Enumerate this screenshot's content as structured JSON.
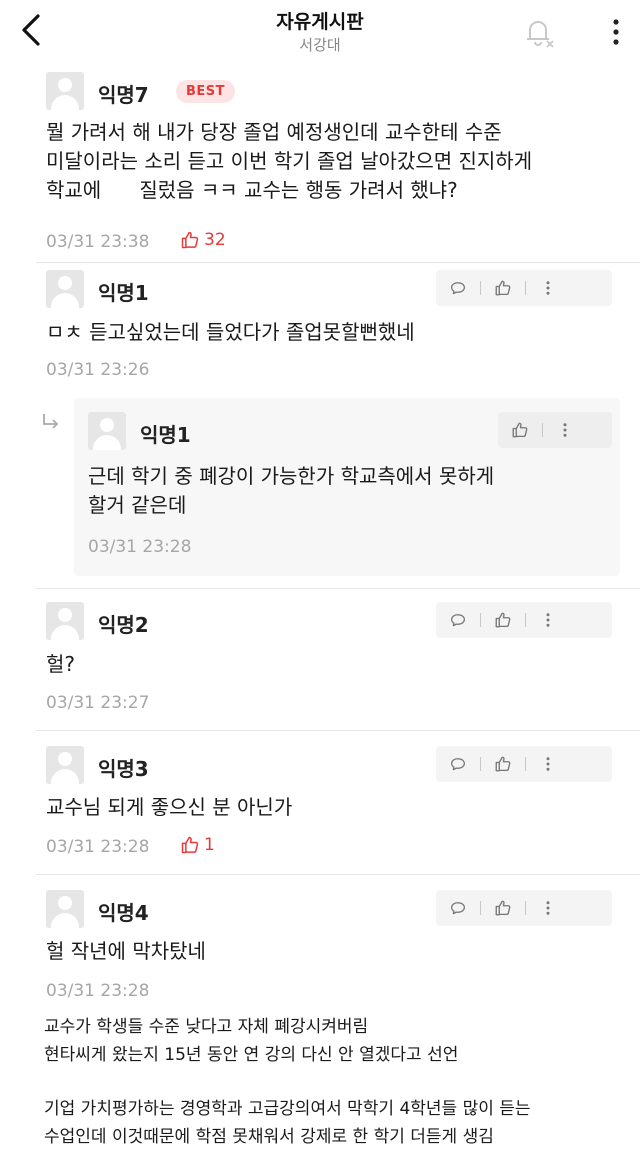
{
  "header": {
    "title": "자유게시판",
    "subtitle": "서강대"
  },
  "comments": [
    {
      "author": "익명7",
      "badge": "BEST",
      "text_lines": [
        "뭘 가려서 해 내가 당장 졸업 예정생인데 교수한테 수준",
        "미달이라는 소리 듣고 이번 학기 졸업 날아갔으면 진지하게",
        "학교에      질렀음 ㅋㅋ 교수는 행동 가려서 했냐?"
      ],
      "time": "03/31 23:38",
      "likes": "32"
    },
    {
      "author": "익명1",
      "text_lines": [
        "ㅁㅊ 듣고싶었는데 들었다가 졸업못할뻔했네"
      ],
      "time": "03/31 23:26"
    },
    {
      "author": "익명1",
      "text_lines": [
        "근데 학기 중 폐강이 가능한가 학교측에서 못하게",
        "할거 같은데"
      ],
      "time": "03/31 23:28"
    },
    {
      "author": "익명2",
      "text_lines": [
        "헐?"
      ],
      "time": "03/31 23:27"
    },
    {
      "author": "익명3",
      "text_lines": [
        "교수님 되게 좋으신 분 아닌가"
      ],
      "time": "03/31 23:28",
      "likes": "1"
    },
    {
      "author": "익명4",
      "text_lines": [
        "헐 작년에 막차탔네"
      ],
      "time": "03/31 23:28"
    }
  ],
  "note": {
    "lines": [
      "교수가 학생들 수준 낮다고 자체 폐강시켜버림",
      "현타씨게 왔는지 15년 동안 연 강의 다신 안 열겠다고 선언",
      "기업 가치평가하는 경영학과 고급강의여서 막학기 4학년들 많이 듣는",
      "수업인데 이것때문에 학점 못채워서 강제로 한 학기 더듣게 생김"
    ]
  },
  "icons": {
    "back": "chevron-left-icon",
    "notify": "bell-off-icon",
    "more": "more-vertical-icon",
    "comment": "speech-bubble-icon",
    "like": "thumbs-up-icon",
    "reply": "reply-arrow-icon"
  },
  "colors": {
    "accent": "#e43a3a",
    "muted": "#a6a6a6",
    "action_bg": "#f4f4f4",
    "reply_bg": "#f7f7f7"
  }
}
